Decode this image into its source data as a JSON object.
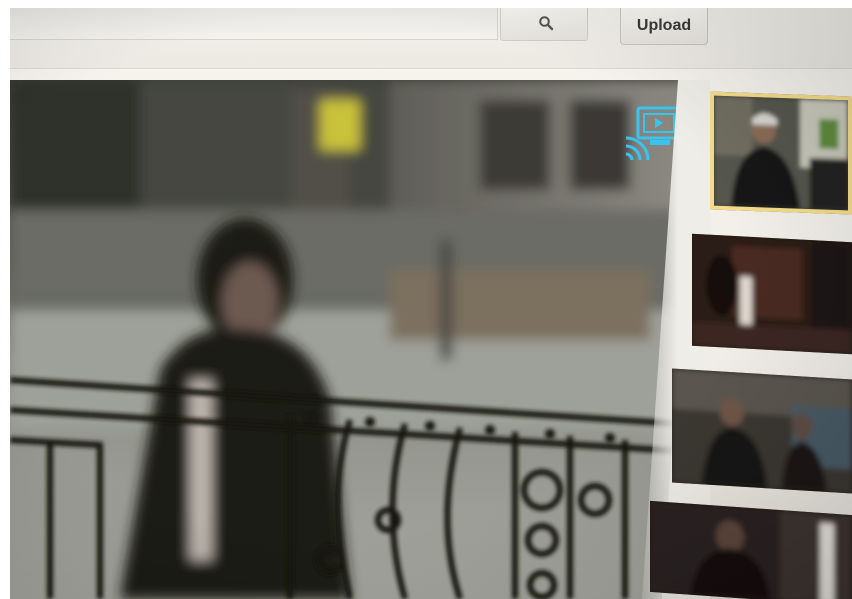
{
  "header": {
    "search": {
      "placeholder": "",
      "value": ""
    },
    "search_icon": "magnifier-icon",
    "upload_label": "Upload"
  },
  "player": {
    "cast_icon": "cast-icon"
  },
  "colors": {
    "cast_accent": "#39c4f0",
    "selected_thumb_border": "#f2dc8c",
    "background": "#efede6"
  },
  "related_videos": [
    {
      "selected": true
    },
    {
      "selected": false
    },
    {
      "selected": false
    },
    {
      "selected": false
    }
  ]
}
